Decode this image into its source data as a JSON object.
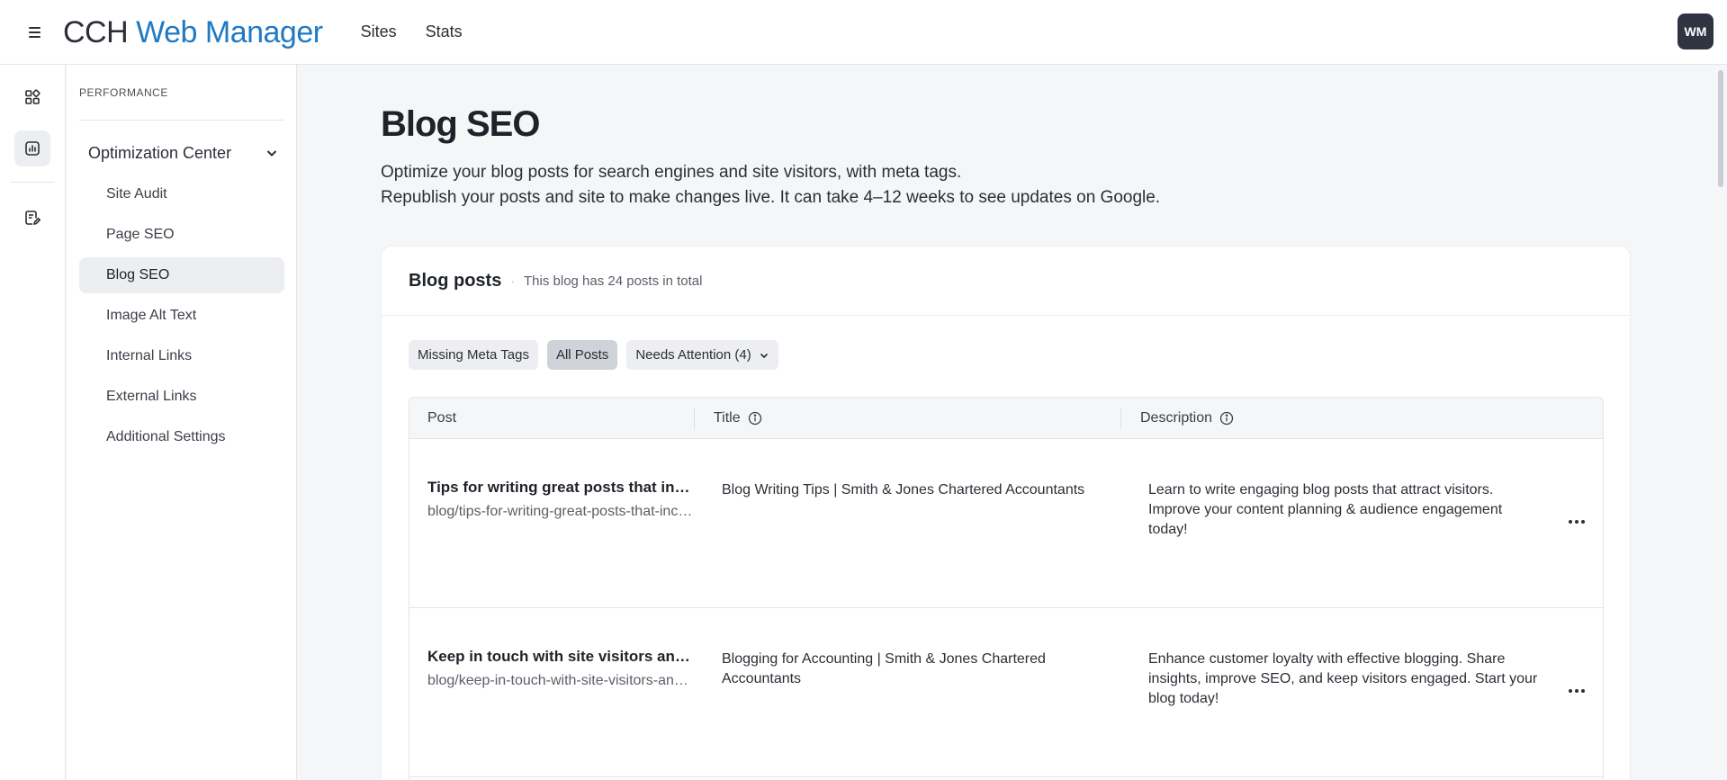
{
  "app": {
    "brand_part1": "CCH",
    "brand_part2": "Web Manager",
    "nav": [
      "Sites",
      "Stats"
    ],
    "avatar_initials": "WM",
    "accent_color": "#1f7ac4"
  },
  "rail": {
    "icons": [
      "dashboard-icon",
      "chart-icon",
      "note-edit-icon"
    ],
    "active_index": 1
  },
  "sidebar": {
    "section": "PERFORMANCE",
    "group_label": "Optimization Center",
    "items": [
      {
        "label": "Site Audit"
      },
      {
        "label": "Page SEO"
      },
      {
        "label": "Blog SEO"
      },
      {
        "label": "Image Alt Text"
      },
      {
        "label": "Internal Links"
      },
      {
        "label": "External Links"
      },
      {
        "label": "Additional Settings"
      }
    ],
    "active_item": "Blog SEO"
  },
  "page": {
    "title": "Blog SEO",
    "desc_line1": "Optimize your blog posts for search engines and site visitors, with meta tags.",
    "desc_line2": "Republish your posts and site to make changes live. It can take 4–12 weeks to see updates on Google."
  },
  "card": {
    "title": "Blog posts",
    "subtitle": "This blog has 24 posts in total",
    "filters": [
      {
        "label": "Missing Meta Tags",
        "active": false
      },
      {
        "label": "All Posts",
        "active": true
      },
      {
        "label": "Needs Attention (4)",
        "active": false,
        "dropdown": true
      }
    ]
  },
  "table": {
    "columns": [
      "Post",
      "Title",
      "Description"
    ],
    "rows": [
      {
        "post_title": "Tips for writing great posts that increase your site traffic",
        "post_slug": "blog/tips-for-writing-great-posts-that-increase-your-site-traffic",
        "title": "Blog Writing Tips | Smith & Jones Chartered Accountants",
        "description": "Learn to write engaging blog posts that attract visitors. Improve your content planning & audience engagement today!"
      },
      {
        "post_title": "Keep in touch with site visitors and customers",
        "post_slug": "blog/keep-in-touch-with-site-visitors-and-customers",
        "title": "Blogging for Accounting | Smith & Jones Chartered Accountants",
        "description": "Enhance customer loyalty with effective blogging. Share insights, improve SEO, and keep visitors engaged. Start your blog today!"
      }
    ]
  }
}
